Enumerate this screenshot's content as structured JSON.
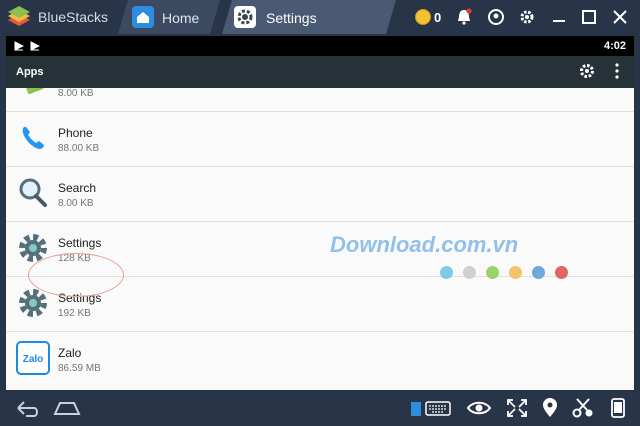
{
  "window": {
    "app_name": "BlueStacks",
    "tabs": [
      {
        "label": "Home",
        "icon": "home-icon"
      },
      {
        "label": "Settings",
        "icon": "gear-icon"
      }
    ],
    "coin_count": "0",
    "toolbar_icons": [
      "coin-icon",
      "bell-icon",
      "account-icon",
      "gear-icon",
      "minimize-icon",
      "maximize-icon",
      "close-icon"
    ]
  },
  "statusbar": {
    "time": "4:02",
    "notification_icons": [
      "download-icon",
      "download-icon"
    ]
  },
  "actionbar": {
    "title": "Apps",
    "icons": [
      "gear-icon",
      "overflow-menu-icon"
    ]
  },
  "apps": [
    {
      "name": "",
      "size": "8.00 KB",
      "icon": "app-icon"
    },
    {
      "name": "Phone",
      "size": "88.00 KB",
      "icon": "phone-icon"
    },
    {
      "name": "Search",
      "size": "8.00 KB",
      "icon": "search-icon"
    },
    {
      "name": "Settings",
      "size": "128 KB",
      "icon": "gear-icon"
    },
    {
      "name": "Settings",
      "size": "192 KB",
      "icon": "gear-icon"
    },
    {
      "name": "Zalo",
      "size": "86.59 MB",
      "icon": "zalo-icon",
      "icon_label": "Zalo"
    }
  ],
  "watermark": {
    "text": "Download.com.vn",
    "dot_colors": [
      "#7ecbe8",
      "#d0d0d0",
      "#9bd36b",
      "#f5c46a",
      "#6fa8dc",
      "#e06666"
    ]
  },
  "bottombar": {
    "icons": [
      "back-icon",
      "home-icon",
      "keyboard-icon",
      "eye-icon",
      "fullscreen-icon",
      "location-icon",
      "scissors-icon",
      "phone-device-icon"
    ]
  },
  "colors": {
    "chrome": "#283548",
    "actionbar": "#263238",
    "accent": "#2d8de0"
  }
}
